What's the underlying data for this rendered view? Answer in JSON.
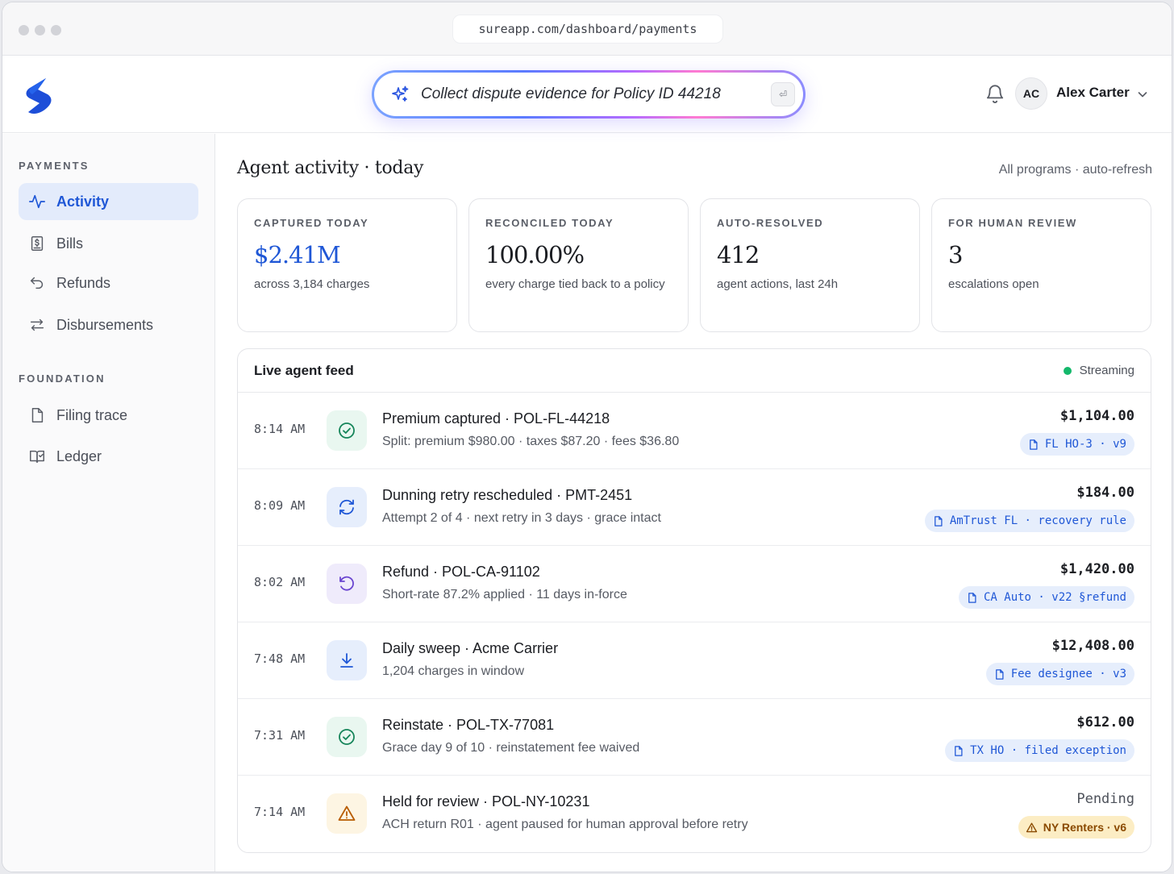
{
  "browser": {
    "url": "sureapp.com/dashboard/payments"
  },
  "header": {
    "logo": "sure-logo",
    "command_query": "Collect dispute evidence for Policy ID 44218",
    "enter_key": "⏎",
    "user_initials": "AC",
    "user_name": "Alex Carter"
  },
  "sidebar": {
    "sections": [
      {
        "label": "PAYMENTS",
        "items": [
          {
            "label": "Activity",
            "icon": "activity-icon",
            "active": true
          },
          {
            "label": "Bills",
            "icon": "bill-icon"
          },
          {
            "label": "Refunds",
            "icon": "undo-icon"
          },
          {
            "label": "Disbursements",
            "icon": "transfer-icon"
          }
        ]
      },
      {
        "label": "FOUNDATION",
        "items": [
          {
            "label": "Filing trace",
            "icon": "file-icon"
          },
          {
            "label": "Ledger",
            "icon": "book-icon"
          }
        ]
      }
    ]
  },
  "main": {
    "title": "Agent activity · today",
    "subtitle": "All programs · auto-refresh",
    "stats": [
      {
        "label": "CAPTURED TODAY",
        "value": "$2.41M",
        "note": "across 3,184 charges",
        "accent": "#1f57d6"
      },
      {
        "label": "RECONCILED TODAY",
        "value": "100.00%",
        "note": "every charge tied back to a policy"
      },
      {
        "label": "AUTO-RESOLVED",
        "value": "412",
        "note": "agent actions, last 24h"
      },
      {
        "label": "FOR HUMAN REVIEW",
        "value": "3",
        "note": "escalations open"
      }
    ],
    "feed": {
      "title": "Live agent feed",
      "status": "Streaming",
      "status_color": "#14b86b",
      "rows": [
        {
          "time": "8:14 AM",
          "icon": "check-circle-icon",
          "title": "Premium captured · POL-FL-44218",
          "desc": "Split: premium $980.00 · taxes $87.20 · fees $36.80",
          "amount": "$1,104.00",
          "tag": "FL HO-3 · v9"
        },
        {
          "time": "8:09 AM",
          "icon": "refresh-icon",
          "title": "Dunning retry rescheduled · PMT-2451",
          "desc": "Attempt 2 of 4 · next retry in 3 days · grace intact",
          "amount": "$184.00",
          "tag": "AmTrust FL · recovery rule"
        },
        {
          "time": "8:02 AM",
          "icon": "rotate-ccw-icon",
          "title": "Refund · POL-CA-91102",
          "desc": "Short-rate 87.2% applied · 11 days in-force",
          "amount": "$1,420.00",
          "tag": "CA Auto · v22 §refund"
        },
        {
          "time": "7:48 AM",
          "icon": "download-icon",
          "title": "Daily sweep · Acme Carrier",
          "desc": "1,204 charges in window",
          "amount": "$12,408.00",
          "tag": "Fee designee · v3"
        },
        {
          "time": "7:31 AM",
          "icon": "check-circle-icon",
          "title": "Reinstate · POL-TX-77081",
          "desc": "Grace day 9 of 10 · reinstatement fee waived",
          "amount": "$612.00",
          "tag": "TX HO · filed exception"
        },
        {
          "time": "7:14 AM",
          "icon": "warning-icon",
          "title": "Held for review · POL-NY-10231",
          "desc": "ACH return R01 · agent paused for human approval before retry",
          "amount": "Pending",
          "tag": "NY Renters · v6"
        }
      ]
    }
  }
}
